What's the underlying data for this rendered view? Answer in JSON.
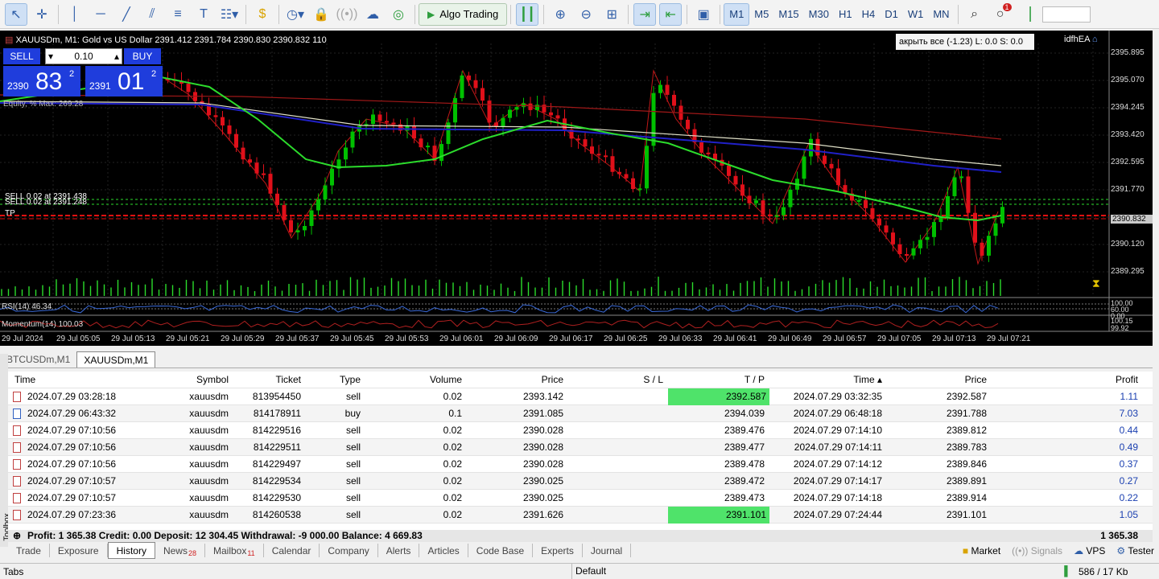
{
  "toolbar": {
    "algo_label": "Algo Trading",
    "timeframes": [
      "M1",
      "M5",
      "M15",
      "M30",
      "H1",
      "H4",
      "D1",
      "W1",
      "MN"
    ],
    "active_timeframe": "M1",
    "notification_count": "1"
  },
  "chart": {
    "header": "XAUUSDm, M1:  Gold vs US Dollar  2391.412 2391.784 2390.830 2390.832  110",
    "ea_label": "idfhEA",
    "close_all_label": "акрыть все (-1.23) L: 0.0 S: 0.0",
    "trade_panel": {
      "sell_label": "SELL",
      "buy_label": "BUY",
      "lot": "0.10",
      "sell_small": "2390",
      "sell_big": "83",
      "sell_sup": "2",
      "buy_small": "2391",
      "buy_big": "01",
      "buy_sup": "2"
    },
    "equity_label": "Equity, %  Max: 269.28",
    "sell_line_1": "SELL 0.02 at 2391.438",
    "sell_line_2": "SELL 0.02 at 2391.248",
    "tp_label": "TP",
    "price_scale": [
      "2395.895",
      "2395.070",
      "2394.245",
      "2393.420",
      "2392.595",
      "2391.770",
      "2390.832",
      "2390.120",
      "2389.295"
    ],
    "current_price": "2390.832",
    "rsi_label": "RSI(14) 46.34",
    "rsi_scale": [
      "100.00",
      "60.00",
      "0.00"
    ],
    "momentum_label": "Momentum(14) 100.03",
    "momentum_scale": [
      "100.15",
      "99.92"
    ],
    "time_labels": [
      "29 Jul 2024",
      "29 Jul 05:05",
      "29 Jul 05:13",
      "29 Jul 05:21",
      "29 Jul 05:29",
      "29 Jul 05:37",
      "29 Jul 05:45",
      "29 Jul 05:53",
      "29 Jul 06:01",
      "29 Jul 06:09",
      "29 Jul 06:17",
      "29 Jul 06:25",
      "29 Jul 06:33",
      "29 Jul 06:41",
      "29 Jul 06:49",
      "29 Jul 06:57",
      "29 Jul 07:05",
      "29 Jul 07:13",
      "29 Jul 07:21"
    ],
    "colors": {
      "bull": "#00c000",
      "bear": "#e0101a",
      "ma_fast": "#2cdc2c",
      "ma_blue": "#2020c8",
      "ma_white": "#e0e0c8",
      "ma_red": "#a01818"
    }
  },
  "symbol_tabs": [
    "BTCUSDm,M1",
    "XAUUSDm,M1"
  ],
  "history": {
    "headers": [
      "Time",
      "Symbol",
      "Ticket",
      "Type",
      "Volume",
      "Price",
      "S / L",
      "T / P",
      "Time",
      "Price",
      "Profit"
    ],
    "rows": [
      [
        "2024.07.29 03:28:18",
        "xauusdm",
        "813954450",
        "sell",
        "0.02",
        "2393.142",
        "",
        "2392.587",
        "2024.07.29 03:32:35",
        "2392.587",
        "1.11"
      ],
      [
        "2024.07.29 06:43:32",
        "xauusdm",
        "814178911",
        "buy",
        "0.1",
        "2391.085",
        "",
        "2394.039",
        "2024.07.29 06:48:18",
        "2391.788",
        "7.03"
      ],
      [
        "2024.07.29 07:10:56",
        "xauusdm",
        "814229516",
        "sell",
        "0.02",
        "2390.028",
        "",
        "2389.476",
        "2024.07.29 07:14:10",
        "2389.812",
        "0.44"
      ],
      [
        "2024.07.29 07:10:56",
        "xauusdm",
        "814229511",
        "sell",
        "0.02",
        "2390.028",
        "",
        "2389.477",
        "2024.07.29 07:14:11",
        "2389.783",
        "0.49"
      ],
      [
        "2024.07.29 07:10:56",
        "xauusdm",
        "814229497",
        "sell",
        "0.02",
        "2390.028",
        "",
        "2389.478",
        "2024.07.29 07:14:12",
        "2389.846",
        "0.37"
      ],
      [
        "2024.07.29 07:10:57",
        "xauusdm",
        "814229534",
        "sell",
        "0.02",
        "2390.025",
        "",
        "2389.472",
        "2024.07.29 07:14:17",
        "2389.891",
        "0.27"
      ],
      [
        "2024.07.29 07:10:57",
        "xauusdm",
        "814229530",
        "sell",
        "0.02",
        "2390.025",
        "",
        "2389.473",
        "2024.07.29 07:14:18",
        "2389.914",
        "0.22"
      ],
      [
        "2024.07.29 07:23:36",
        "xauusdm",
        "814260538",
        "sell",
        "0.02",
        "2391.626",
        "",
        "2391.101",
        "2024.07.29 07:24:44",
        "2391.101",
        "1.05"
      ]
    ],
    "summary_left": "Profit: 1 365.38  Credit: 0.00  Deposit: 12 304.45  Withdrawal: -9 000.00  Balance: 4 669.83",
    "summary_right": "1 365.38"
  },
  "bottom_tabs": [
    {
      "label": "Trade",
      "badge": ""
    },
    {
      "label": "Exposure",
      "badge": ""
    },
    {
      "label": "History",
      "badge": ""
    },
    {
      "label": "News",
      "badge": "28"
    },
    {
      "label": "Mailbox",
      "badge": "11"
    },
    {
      "label": "Calendar",
      "badge": ""
    },
    {
      "label": "Company",
      "badge": ""
    },
    {
      "label": "Alerts",
      "badge": ""
    },
    {
      "label": "Articles",
      "badge": ""
    },
    {
      "label": "Code Base",
      "badge": ""
    },
    {
      "label": "Experts",
      "badge": ""
    },
    {
      "label": "Journal",
      "badge": ""
    }
  ],
  "right_tools": [
    "Market",
    "Signals",
    "VPS",
    "Tester"
  ],
  "toolbox_label": "Toolbox",
  "status": {
    "left": "Tabs",
    "center": "Default",
    "right": "586 / 17 Kb"
  }
}
